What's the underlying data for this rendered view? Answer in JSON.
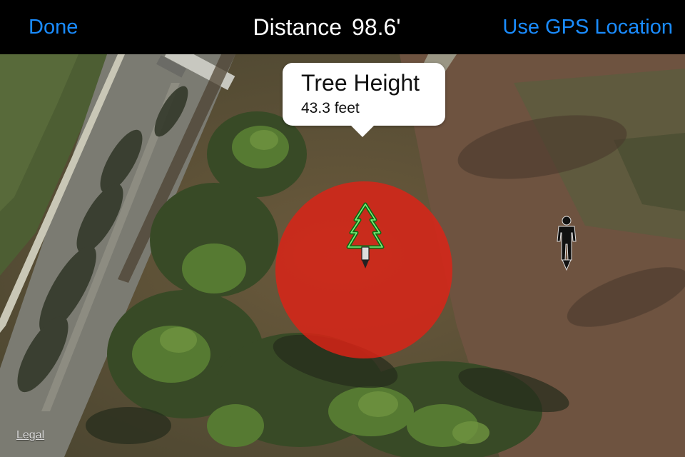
{
  "navbar": {
    "done_label": "Done",
    "title_label": "Distance",
    "distance_value": "98.6'",
    "gps_label": "Use GPS Location"
  },
  "callout": {
    "title": "Tree Height",
    "subtitle": "43.3 feet"
  },
  "map": {
    "legal_label": "Legal",
    "range_circle_color": "#de2216",
    "tree_pin_icon": "tree-icon",
    "person_pin_icon": "person-icon"
  },
  "colors": {
    "accent": "#1a8cff",
    "navbar_bg": "#000000",
    "tree_outline": "#1e8a1e"
  }
}
